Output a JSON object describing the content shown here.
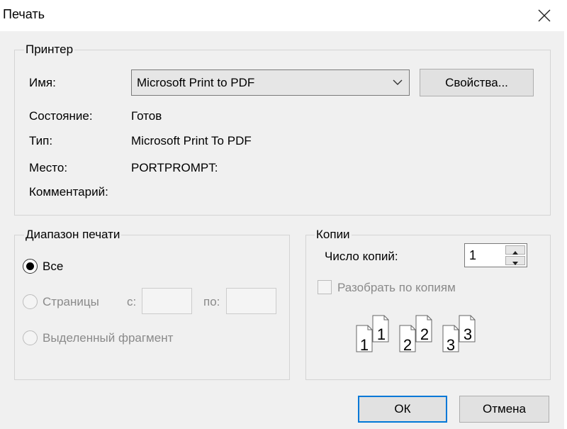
{
  "window": {
    "title": "Печать",
    "close_icon": "close-icon"
  },
  "printer_group": {
    "legend": "Принтер",
    "name_label": "Имя:",
    "name_value": "Microsoft Print to PDF",
    "properties_label": "Свойства...",
    "status_label": "Состояние:",
    "status_value": "Готов",
    "type_label": "Тип:",
    "type_value": "Microsoft Print To PDF",
    "location_label": "Место:",
    "location_value": "PORTPROMPT:",
    "comment_label": "Комментарий:"
  },
  "range_group": {
    "legend": "Диапазон печати",
    "all_label": "Все",
    "pages_label": "Страницы",
    "from_label": "с:",
    "to_label": "по:",
    "selection_label": "Выделенный фрагмент",
    "selected": "all"
  },
  "copies_group": {
    "legend": "Копии",
    "count_label": "Число копий:",
    "count_value": "1",
    "collate_label": "Разобрать по копиям",
    "collate_checked": false,
    "collate_icon": "collate-pages-icon",
    "collate_numbers": [
      "1",
      "1",
      "2",
      "2",
      "3",
      "3"
    ]
  },
  "buttons": {
    "ok_label": "ОК",
    "cancel_label": "Отмена"
  },
  "colors": {
    "accent": "#0078d7",
    "disabled_text": "#8a8a8a",
    "background": "#f0f0f0"
  }
}
